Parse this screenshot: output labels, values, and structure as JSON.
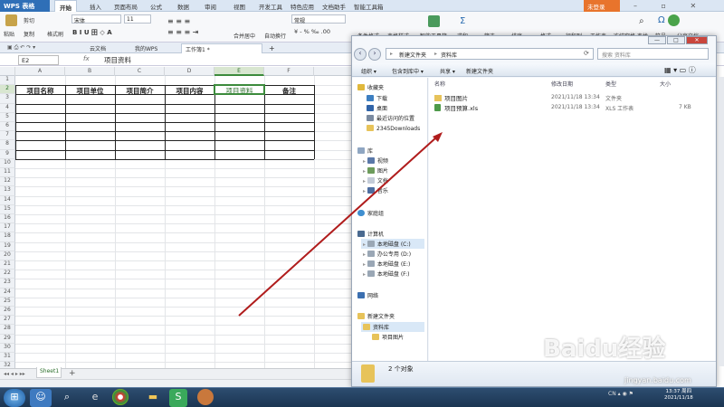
{
  "wps": {
    "logo": "WPS 表格",
    "menus": [
      "开始",
      "插入",
      "页面布局",
      "公式",
      "数据",
      "审阅",
      "视图",
      "开发工具",
      "特色应用",
      "文档助手",
      "智能工具箱"
    ],
    "login": "未登录",
    "ribbon": {
      "cut": "剪切",
      "copy": "复制",
      "format_painter": "格式刷",
      "paste": "粘贴",
      "font": "宋体",
      "font_size": "11",
      "number_format": "常规",
      "merge": "合并居中",
      "wrap": "自动换行",
      "cond": "条件格式",
      "table_style": "表格样式",
      "smart_toolbox": "智能工具箱",
      "sum": "求和",
      "filter": "筛选",
      "sort": "排序",
      "format": "格式",
      "row_col": "行和列",
      "worksheet": "工作表",
      "freeze": "冻结窗格",
      "find": "查找",
      "symbol": "符号",
      "share": "分享文档"
    },
    "doc_tabs": [
      "云文档",
      "我的WPS",
      "工作簿1 *"
    ],
    "formula_bar": {
      "cell_ref": "E2",
      "fx": "fx",
      "value": "项目资料"
    },
    "columns": [
      "A",
      "B",
      "C",
      "D",
      "E",
      "F"
    ],
    "rows": [
      "1",
      "2",
      "3",
      "4",
      "5",
      "6",
      "7",
      "8",
      "9",
      "10",
      "11",
      "12",
      "13",
      "14",
      "15",
      "16",
      "17",
      "18",
      "19",
      "20",
      "21",
      "22",
      "23",
      "24",
      "25",
      "26",
      "27",
      "28",
      "29",
      "30",
      "31",
      "32"
    ],
    "header_row": [
      "项目名称",
      "项目单位",
      "项目简介",
      "项目内容",
      "项目资料",
      "备注"
    ],
    "sheet": "Sheet1"
  },
  "explorer": {
    "window_buttons": [
      "—",
      "□",
      "✕"
    ],
    "address": [
      "新建文件夹",
      "资料库"
    ],
    "search_placeholder": "搜索 资料库",
    "commands": [
      "组织 ▾",
      "包含到库中 ▾",
      "共享 ▾",
      "新建文件夹"
    ],
    "nav": {
      "favorites": "收藏夹",
      "fav_items": [
        "下载",
        "桌面",
        "最近访问的位置",
        "2345Downloads"
      ],
      "libraries": "库",
      "lib_items": [
        "视频",
        "图片",
        "文档",
        "音乐"
      ],
      "homegroup": "家庭组",
      "computer": "计算机",
      "drives": [
        "本地磁盘 (C:)",
        "办公专用 (D:)",
        "本地磁盘 (E:)",
        "本地磁盘 (F:)"
      ],
      "network": "网络",
      "folder_tree": [
        "新建文件夹",
        "资料库",
        "项目图片"
      ]
    },
    "columns": [
      "名称",
      "修改日期",
      "类型",
      "大小"
    ],
    "files": [
      {
        "name": "项目图片",
        "date": "2021/11/18 13:34",
        "type": "文件夹",
        "size": ""
      },
      {
        "name": "项目预算.xls",
        "date": "2021/11/18 13:34",
        "type": "XLS 工作表",
        "size": "7 KB"
      }
    ],
    "status": "2 个对象"
  },
  "taskbar": {
    "time": "13:37 周四",
    "date": "2021/11/18",
    "lang": "CN"
  },
  "watermark": {
    "main": "Baidu经验",
    "sub": "jingyan.baidu.com"
  },
  "colors": {
    "wps_blue": "#2f6fb7",
    "arrow": "#b01c1c",
    "selection": "#3c8b3c"
  }
}
